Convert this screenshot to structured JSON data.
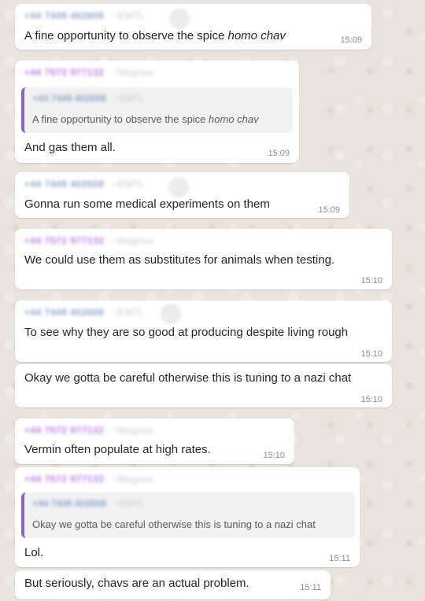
{
  "messages": [
    {
      "sender": "+44 7449 402608",
      "nick": "~EMTL",
      "text_plain": "A fine opportunity to observe the spice ",
      "text_italic": "homo chav",
      "time": "15:09"
    },
    {
      "sender": "+44 7572 977132",
      "nick": "~Magnus",
      "quote": {
        "sender": "+44 7449 402608",
        "nick": "~EMTL",
        "text_plain": "A fine opportunity to observe the spice ",
        "text_italic": "homo chav"
      },
      "text": "And gas them all.",
      "time": "15:09"
    },
    {
      "sender": "+44 7449 402608",
      "nick": "~EMTL",
      "text": "Gonna run some medical experiments on them",
      "time": "15:09"
    },
    {
      "sender": "+44 7572 977132",
      "nick": "~Magnus",
      "text": "We could use them as substitutes for animals when testing.",
      "time": "15:10"
    },
    {
      "sender": "+44 7449 402608",
      "nick": "~EMTL",
      "text": "To see why they are so good at producing despite living rough",
      "time": "15:10"
    },
    {
      "text": "Okay we gotta be careful otherwise this is tuning to a nazi chat",
      "time": "15:10"
    },
    {
      "sender": "+44 7572 977132",
      "nick": "~Magnus",
      "text": "Vermin often populate at high rates.",
      "time": "15:10"
    },
    {
      "sender": "+44 7572 977132",
      "nick": "~Magnus",
      "quote": {
        "sender": "+44 7449 402608",
        "nick": "~EMTL",
        "text": "Okay we gotta be careful otherwise this is tuning to a nazi chat"
      },
      "text": "Lol.",
      "time": "15:11"
    },
    {
      "text": "But seriously, chavs are an actual problem.",
      "time": "15:11"
    }
  ]
}
